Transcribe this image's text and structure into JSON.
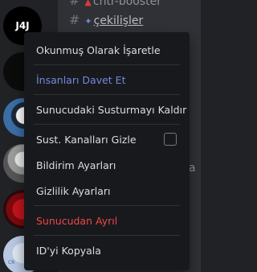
{
  "servers": [
    {
      "label": "J4J"
    },
    {
      "label": ""
    },
    {
      "label": ""
    },
    {
      "label": ""
    },
    {
      "label": ""
    },
    {
      "label": "CR"
    }
  ],
  "channels": [
    {
      "name": "cntr-booster"
    },
    {
      "name": "çekilişler"
    }
  ],
  "partial_text": "la",
  "menu": {
    "mark_read": "Okunmuş Olarak İşaretle",
    "invite": "İnsanları Davet Et",
    "unmute": "Sunucudaki Susturmayı Kaldır",
    "hide_muted": "Sust. Kanalları Gizle",
    "notifications": "Bildirim Ayarları",
    "privacy": "Gizlilik Ayarları",
    "leave": "Sunucudan Ayrıl",
    "copy_id": "ID'yi Kopyala"
  },
  "colors": {
    "menu_bg": "#18191c",
    "accent": "#7289da",
    "danger": "#f04747",
    "text": "#dcddde"
  }
}
